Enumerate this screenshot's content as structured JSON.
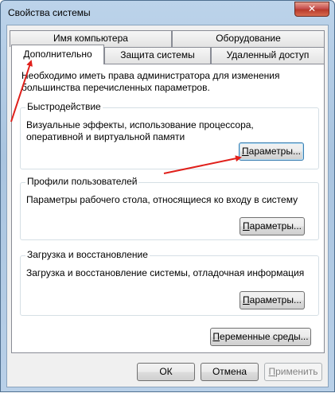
{
  "window": {
    "title": "Свойства системы",
    "close_glyph": "✕"
  },
  "tabs": {
    "computer_name": "Имя компьютера",
    "hardware": "Оборудование",
    "advanced": "Дополнительно",
    "system_protection": "Защита системы",
    "remote": "Удаленный доступ"
  },
  "intro": "Необходимо иметь права администратора для изменения большинства перечисленных параметров.",
  "performance": {
    "title": "Быстродействие",
    "desc": "Визуальные эффекты, использование процессора, оперативной и виртуальной памяти",
    "btn_u": "П",
    "btn_rest": "араметры..."
  },
  "profiles": {
    "title": "Профили пользователей",
    "desc": "Параметры рабочего стола, относящиеся ко входу в систему",
    "btn_u": "П",
    "btn_rest": "араметры..."
  },
  "startup": {
    "title": "Загрузка и восстановление",
    "desc": "Загрузка и восстановление системы, отладочная информация",
    "btn_u": "П",
    "btn_rest": "араметры..."
  },
  "env_button": {
    "u": "П",
    "rest": "еременные среды..."
  },
  "footer": {
    "ok": "ОК",
    "cancel": "Отмена",
    "apply_u": "П",
    "apply_rest": "рименить"
  },
  "colors": {
    "annotation_arrow": "#e0201b"
  }
}
